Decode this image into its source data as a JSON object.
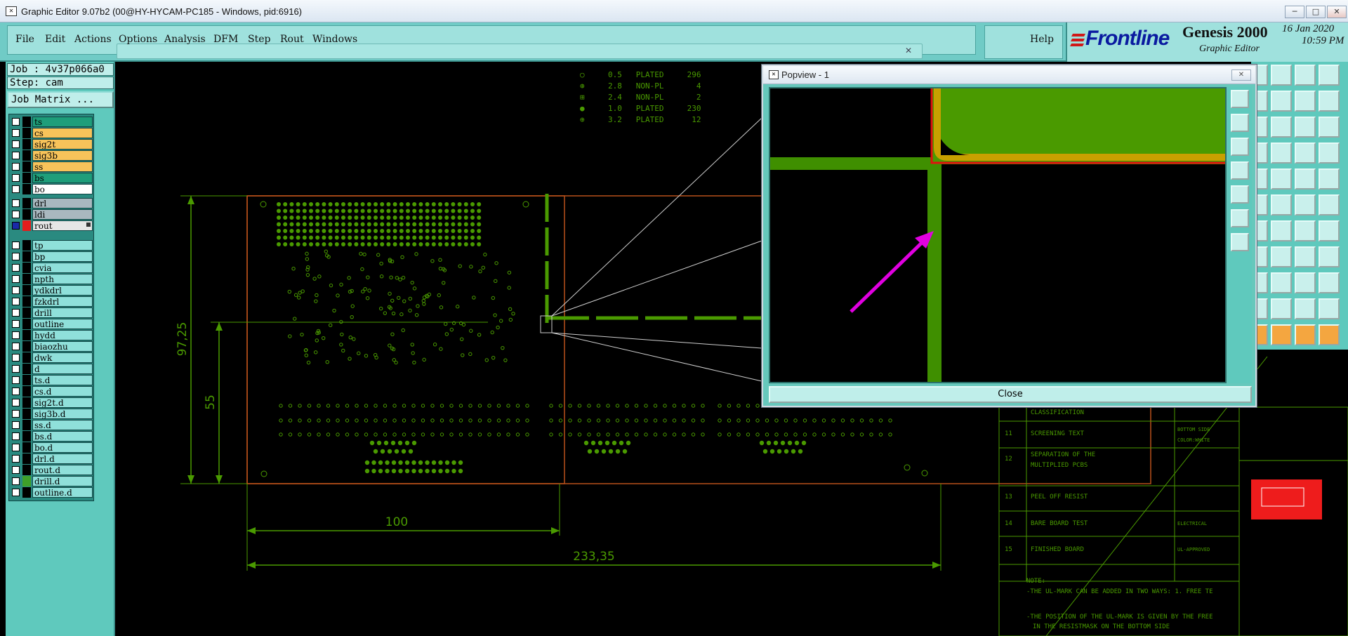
{
  "window": {
    "title": "Graphic Editor 9.07b2 (00@HY-HYCAM-PC185 - Windows, pid:6916)",
    "min_label": "─",
    "max_label": "□",
    "close_label": "✕"
  },
  "menu": {
    "file": "File",
    "edit": "Edit",
    "actions": "Actions",
    "options": "Options",
    "analysis": "Analysis",
    "dfm": "DFM",
    "step": "Step",
    "rout": "Rout",
    "windows": "Windows",
    "help": "Help"
  },
  "brand": {
    "logo": "Frontline",
    "product": "Genesis 2000",
    "subtitle": "Graphic Editor",
    "date": "16 Jan 2020",
    "time": "10:59 PM"
  },
  "job": {
    "job_label": "Job : 4v37p066a0",
    "step_label": "Step: cam",
    "matrix_button": "Job Matrix ..."
  },
  "layers": [
    {
      "name": "ts",
      "color": "#1e9e7a",
      "swatch": "#000"
    },
    {
      "name": "cs",
      "color": "#f7c35a",
      "swatch": "#000"
    },
    {
      "name": "sig2t",
      "color": "#f7c35a",
      "swatch": "#000"
    },
    {
      "name": "sig3b",
      "color": "#f7c35a",
      "swatch": "#000"
    },
    {
      "name": "ss",
      "color": "#f7c35a",
      "swatch": "#000"
    },
    {
      "name": "bs",
      "color": "#1e9e7a",
      "swatch": "#000"
    },
    {
      "name": "bo",
      "color": "#ffffff",
      "swatch": "#000"
    },
    {
      "name": "drl",
      "color": "#a9b8bf",
      "swatch": "#000"
    },
    {
      "name": "ldi",
      "color": "#a9b8bf",
      "swatch": "#000"
    },
    {
      "name": "rout",
      "color": "#e6e6e6",
      "swatch": "#e31d1d"
    },
    {
      "name": "tp",
      "color": "#8fe0da",
      "swatch": "#000"
    },
    {
      "name": "bp",
      "color": "#8fe0da",
      "swatch": "#000"
    },
    {
      "name": "cvia",
      "color": "#8fe0da",
      "swatch": "#000"
    },
    {
      "name": "npth",
      "color": "#8fe0da",
      "swatch": "#000"
    },
    {
      "name": "ydkdrl",
      "color": "#8fe0da",
      "swatch": "#000"
    },
    {
      "name": "fzkdrl",
      "color": "#8fe0da",
      "swatch": "#000"
    },
    {
      "name": "drill",
      "color": "#8fe0da",
      "swatch": "#000"
    },
    {
      "name": "outline",
      "color": "#8fe0da",
      "swatch": "#000"
    },
    {
      "name": "hydd",
      "color": "#8fe0da",
      "swatch": "#000"
    },
    {
      "name": "biaozhu",
      "color": "#8fe0da",
      "swatch": "#000"
    },
    {
      "name": "dwk",
      "color": "#8fe0da",
      "swatch": "#000"
    },
    {
      "name": "d",
      "color": "#8fe0da",
      "swatch": "#000"
    },
    {
      "name": "ts.d",
      "color": "#8fe0da",
      "swatch": "#000"
    },
    {
      "name": "cs.d",
      "color": "#8fe0da",
      "swatch": "#000"
    },
    {
      "name": "sig2t.d",
      "color": "#8fe0da",
      "swatch": "#000"
    },
    {
      "name": "sig3b.d",
      "color": "#8fe0da",
      "swatch": "#000"
    },
    {
      "name": "ss.d",
      "color": "#8fe0da",
      "swatch": "#000"
    },
    {
      "name": "bs.d",
      "color": "#8fe0da",
      "swatch": "#000"
    },
    {
      "name": "bo.d",
      "color": "#8fe0da",
      "swatch": "#000"
    },
    {
      "name": "drl.d",
      "color": "#8fe0da",
      "swatch": "#000"
    },
    {
      "name": "rout.d",
      "color": "#8fe0da",
      "swatch": "#000"
    },
    {
      "name": "drill.d",
      "color": "#8fe0da",
      "swatch": "#3fa02a"
    },
    {
      "name": "outline.d",
      "color": "#8fe0da",
      "swatch": "#000"
    }
  ],
  "drill_table": [
    "0.5   PLATED     296",
    "2.8   NON-PL       4",
    "2.4   NON-PL       2",
    "1.0   PLATED     230",
    "3.2   PLATED      12"
  ],
  "dimensions": {
    "height_total": "97,25",
    "height_inner": "55",
    "width_inner": "100",
    "width_total": "233,35"
  },
  "spec_table": [
    {
      "no": "",
      "text": "CLASSIFICATION",
      "value": ""
    },
    {
      "no": "11",
      "text": "SCREENING TEXT",
      "value": "BOTTOM SIDE\nCOLOR:WHITE"
    },
    {
      "no": "12",
      "text": "SEPARATION OF THE\nMULTIPLIED PCBS",
      "value": ""
    },
    {
      "no": "13",
      "text": "PEEL OFF RESIST",
      "value": ""
    },
    {
      "no": "14",
      "text": "BARE BOARD TEST",
      "value": "ELECTRICAL"
    },
    {
      "no": "15",
      "text": "FINISHED BOARD",
      "value": "UL-APPROVED"
    }
  ],
  "notes": {
    "heading": "NOTE:",
    "line1": "-THE UL-MARK CAN BE ADDED IN TWO WAYS: 1. FREE TE",
    "line2": "-THE POSITION OF THE UL-MARK IS GIVEN BY THE FREE",
    "line3": "IN THE RESISTMASK ON THE BOTTOM SIDE"
  },
  "popview": {
    "title": "Popview - 1",
    "close_button": "Close",
    "close_x": "✕"
  },
  "colors": {
    "trace_green": "#4a9a00",
    "rout_yellow": "#c8a000",
    "outline_red": "#e01010",
    "annotation_arrow": "#e000e0",
    "ui_teal": "#5fc9bd"
  }
}
